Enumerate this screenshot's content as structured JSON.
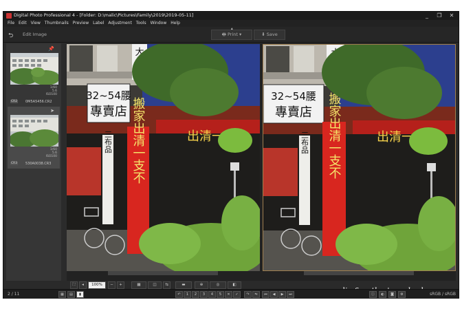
{
  "window": {
    "title": "Digital Photo Professional 4 - [Folder: D:\\malic\\Pictures\\Family\\2019\\2019-05-11]",
    "minimize": "_",
    "maximize": "❐",
    "close": "✕"
  },
  "menu": [
    "File",
    "Edit",
    "View",
    "Thumbnails",
    "Preview",
    "Label",
    "Adjustment",
    "Tools",
    "Window",
    "Help"
  ],
  "toolbar": {
    "back_glyph": "⮌",
    "edit_label": "Edit Image",
    "print_label": "Print",
    "save_label": "Save"
  },
  "filmstrip": {
    "items": [
      {
        "filename": "0M5A5456.CR2",
        "shutter": "1/60",
        "aperture": "5.6",
        "iso": "ISO100",
        "badge": "CR2"
      },
      {
        "filename": "530A0038.CR3",
        "shutter": "1/60",
        "aperture": "5.6",
        "iso": "ISO100",
        "badge": "CR3"
      }
    ]
  },
  "viewer": {
    "sign_top": "32~54腰",
    "sign_bottom": "專賣店",
    "banner_vertical": "搬家出清一支不",
    "banner_horizontal": "出清一",
    "shop_vertical": "三布品",
    "sign_top2": "大"
  },
  "bottombar": {
    "zoom": "100%"
  },
  "status": {
    "count": "2 / 11",
    "colorspace": "sRGB / sRGB"
  },
  "watermark": "malic & esther's underdog",
  "colors": {
    "bg": "#2b2b2b",
    "banner_red": "#d8261f",
    "sign_white": "#f2f2f2",
    "awning_blue": "#2c3f8e",
    "foliage": "#6fa43a"
  }
}
